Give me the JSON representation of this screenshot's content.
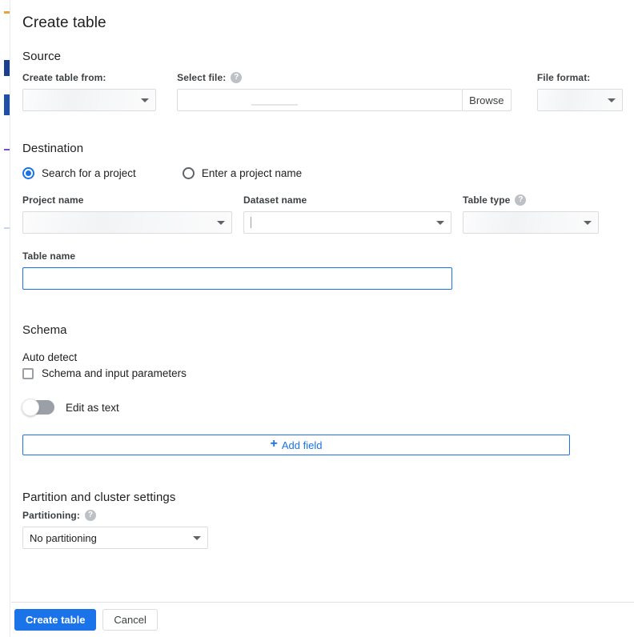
{
  "dialog": {
    "title": "Create table"
  },
  "source": {
    "section_title": "Source",
    "create_table_from": {
      "label": "Create table from:",
      "value": ""
    },
    "select_file": {
      "label": "Select file:",
      "help_icon": "help-icon",
      "value": "",
      "browse_label": "Browse"
    },
    "file_format": {
      "label": "File format:",
      "value": ""
    }
  },
  "destination": {
    "section_title": "Destination",
    "radio_options": [
      {
        "label": "Search for a project",
        "selected": true
      },
      {
        "label": "Enter a project name",
        "selected": false
      }
    ],
    "project_name": {
      "label": "Project name",
      "value": ""
    },
    "dataset_name": {
      "label": "Dataset name",
      "value": ""
    },
    "table_type": {
      "label": "Table type",
      "help_icon": "help-icon",
      "value": ""
    },
    "table_name": {
      "label": "Table name",
      "value": ""
    }
  },
  "schema": {
    "section_title": "Schema",
    "auto_detect_label": "Auto detect",
    "auto_detect_checkbox": {
      "label": "Schema and input parameters",
      "checked": false
    },
    "edit_as_text": {
      "label": "Edit as text",
      "enabled": false
    },
    "add_field_label": "Add field",
    "add_field_icon": "plus-icon"
  },
  "partition": {
    "section_title": "Partition and cluster settings",
    "partitioning": {
      "label": "Partitioning:",
      "help_icon": "help-icon",
      "value": "No partitioning"
    }
  },
  "footer": {
    "create_label": "Create table",
    "cancel_label": "Cancel"
  },
  "colors": {
    "accent_blue": "#1a73e8",
    "border_gray": "#dadce0",
    "text_primary": "#202124",
    "text_secondary": "#3c4043",
    "icon_gray": "#bdc1c6"
  }
}
